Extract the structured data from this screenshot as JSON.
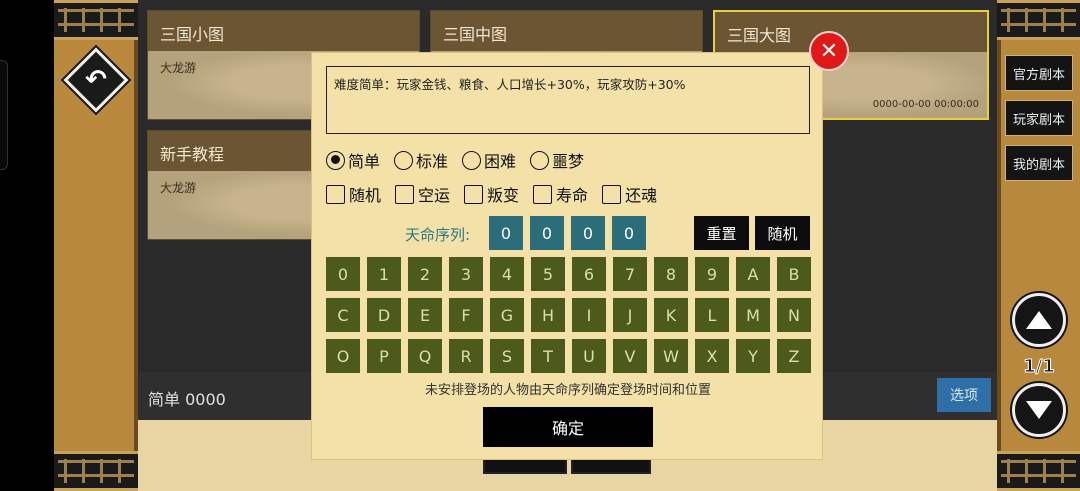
{
  "scenario_cards": [
    {
      "title": "三国小图",
      "subtitle": "大龙游"
    },
    {
      "title": "三国中图",
      "subtitle": ""
    },
    {
      "title": "三国大图",
      "subtitle": "",
      "date": "0000-00-00 00:00:00"
    },
    {
      "title": "新手教程",
      "subtitle": "大龙游"
    }
  ],
  "bottom_bar": {
    "summary": "简单 0000",
    "options_label": "选项"
  },
  "right_tabs": [
    "官方剧本",
    "玩家剧本",
    "我的剧本"
  ],
  "pagination": {
    "indicator": "1/1"
  },
  "dialog": {
    "description": "难度简单：玩家金钱、粮食、人口增长+30%，玩家攻防+30%",
    "difficulty": [
      {
        "label": "简单",
        "selected": true
      },
      {
        "label": "标准",
        "selected": false
      },
      {
        "label": "困难",
        "selected": false
      },
      {
        "label": "噩梦",
        "selected": false
      }
    ],
    "toggles": [
      {
        "label": "随机",
        "checked": false
      },
      {
        "label": "空运",
        "checked": false
      },
      {
        "label": "叛变",
        "checked": false
      },
      {
        "label": "寿命",
        "checked": false
      },
      {
        "label": "还魂",
        "checked": false
      }
    ],
    "sequence_label": "天命序列:",
    "sequence": [
      "0",
      "0",
      "0",
      "0"
    ],
    "reset_label": "重置",
    "random_label": "随机",
    "keys": [
      "0",
      "1",
      "2",
      "3",
      "4",
      "5",
      "6",
      "7",
      "8",
      "9",
      "A",
      "B",
      "C",
      "D",
      "E",
      "F",
      "G",
      "H",
      "I",
      "J",
      "K",
      "L",
      "M",
      "N",
      "O",
      "P",
      "Q",
      "R",
      "S",
      "T",
      "U",
      "V",
      "W",
      "X",
      "Y",
      "Z"
    ],
    "hint": "未安排登场的人物由天命序列确定登场时间和位置",
    "confirm_label": "确定"
  },
  "colors": {
    "dialog_bg": "#f3e1a7",
    "key_bg": "#4c5a1c",
    "sequence_bg": "#2b6e7a",
    "close_red": "#e01818",
    "options_blue": "#2f6fa8",
    "frame_gold": "#b8883c"
  },
  "icons": {
    "back": "back-arrow-icon",
    "close": "close-icon",
    "up": "triangle-up-icon",
    "down": "triangle-down-icon"
  }
}
